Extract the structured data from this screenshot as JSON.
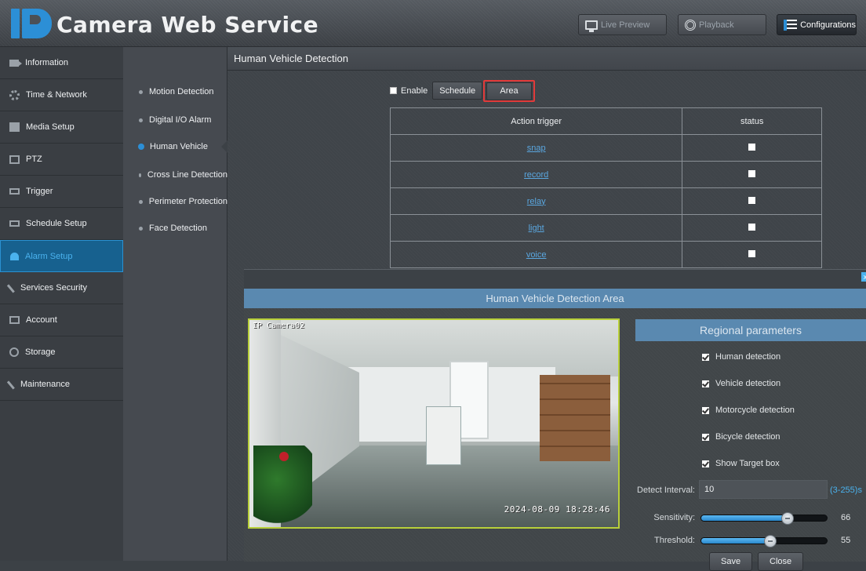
{
  "header": {
    "logo_text": "Camera Web Service",
    "buttons": [
      {
        "label": "Live Preview",
        "icon": "monitor-icon"
      },
      {
        "label": "Playback",
        "icon": "film-reel-icon"
      },
      {
        "label": "Configurations",
        "icon": "list-icon",
        "active": true
      }
    ]
  },
  "nav": {
    "items": [
      {
        "label": "Information",
        "icon": "camera-icon"
      },
      {
        "label": "Time & Network",
        "icon": "gear-icon"
      },
      {
        "label": "Media Setup",
        "icon": "media-icon"
      },
      {
        "label": "PTZ",
        "icon": "ptz-icon"
      },
      {
        "label": "Trigger",
        "icon": "trigger-icon"
      },
      {
        "label": "Schedule Setup",
        "icon": "schedule-icon"
      },
      {
        "label": "Alarm Setup",
        "icon": "alarm-icon",
        "active": true
      },
      {
        "label": "Services Security",
        "icon": "wrench-icon"
      },
      {
        "label": "Account",
        "icon": "monitor-icon"
      },
      {
        "label": "Storage",
        "icon": "storage-icon"
      },
      {
        "label": "Maintenance",
        "icon": "wrench-icon"
      }
    ]
  },
  "subnav": {
    "items": [
      {
        "label": "Motion Detection"
      },
      {
        "label": "Digital I/O Alarm"
      },
      {
        "label": "Human Vehicle",
        "active": true
      },
      {
        "label": "Cross Line Detection"
      },
      {
        "label": "Perimeter Protection"
      },
      {
        "label": "Face Detection"
      }
    ]
  },
  "main": {
    "title": "Human Vehicle Detection",
    "enable_label": "Enable",
    "enable_checked": false,
    "schedule_label": "Schedule",
    "area_label": "Area",
    "table": {
      "headers": [
        "Action trigger",
        "status"
      ],
      "rows": [
        {
          "action": "snap",
          "checked": false
        },
        {
          "action": "record",
          "checked": false
        },
        {
          "action": "relay",
          "checked": false
        },
        {
          "action": "light",
          "checked": false
        },
        {
          "action": "voice",
          "checked": false
        }
      ]
    }
  },
  "modal": {
    "close_glyph": "x",
    "title": "Human Vehicle Detection Area",
    "video": {
      "camera_name": "IP Camera02",
      "timestamp": "2024-08-09 18:28:46"
    },
    "regional_title": "Regional parameters",
    "checks": [
      {
        "label": "Human detection",
        "checked": true
      },
      {
        "label": "Vehicle detection",
        "checked": true
      },
      {
        "label": "Motorcycle detection",
        "checked": true
      },
      {
        "label": "Bicycle detection",
        "checked": true
      },
      {
        "label": "Show Target box",
        "checked": true
      }
    ],
    "interval_label": "Detect Interval:",
    "interval_value": "10",
    "interval_range": "(3-255)s",
    "sensitivity_label": "Sensitivity:",
    "sensitivity_value": "66",
    "threshold_label": "Threshold:",
    "threshold_value": "55",
    "save_label": "Save",
    "close_label": "Close"
  },
  "colors": {
    "accent": "#2c8fd6",
    "highlight_border": "#e23a3a",
    "modal_title_bg": "#5a89b0",
    "video_border": "#b8cf3a"
  }
}
